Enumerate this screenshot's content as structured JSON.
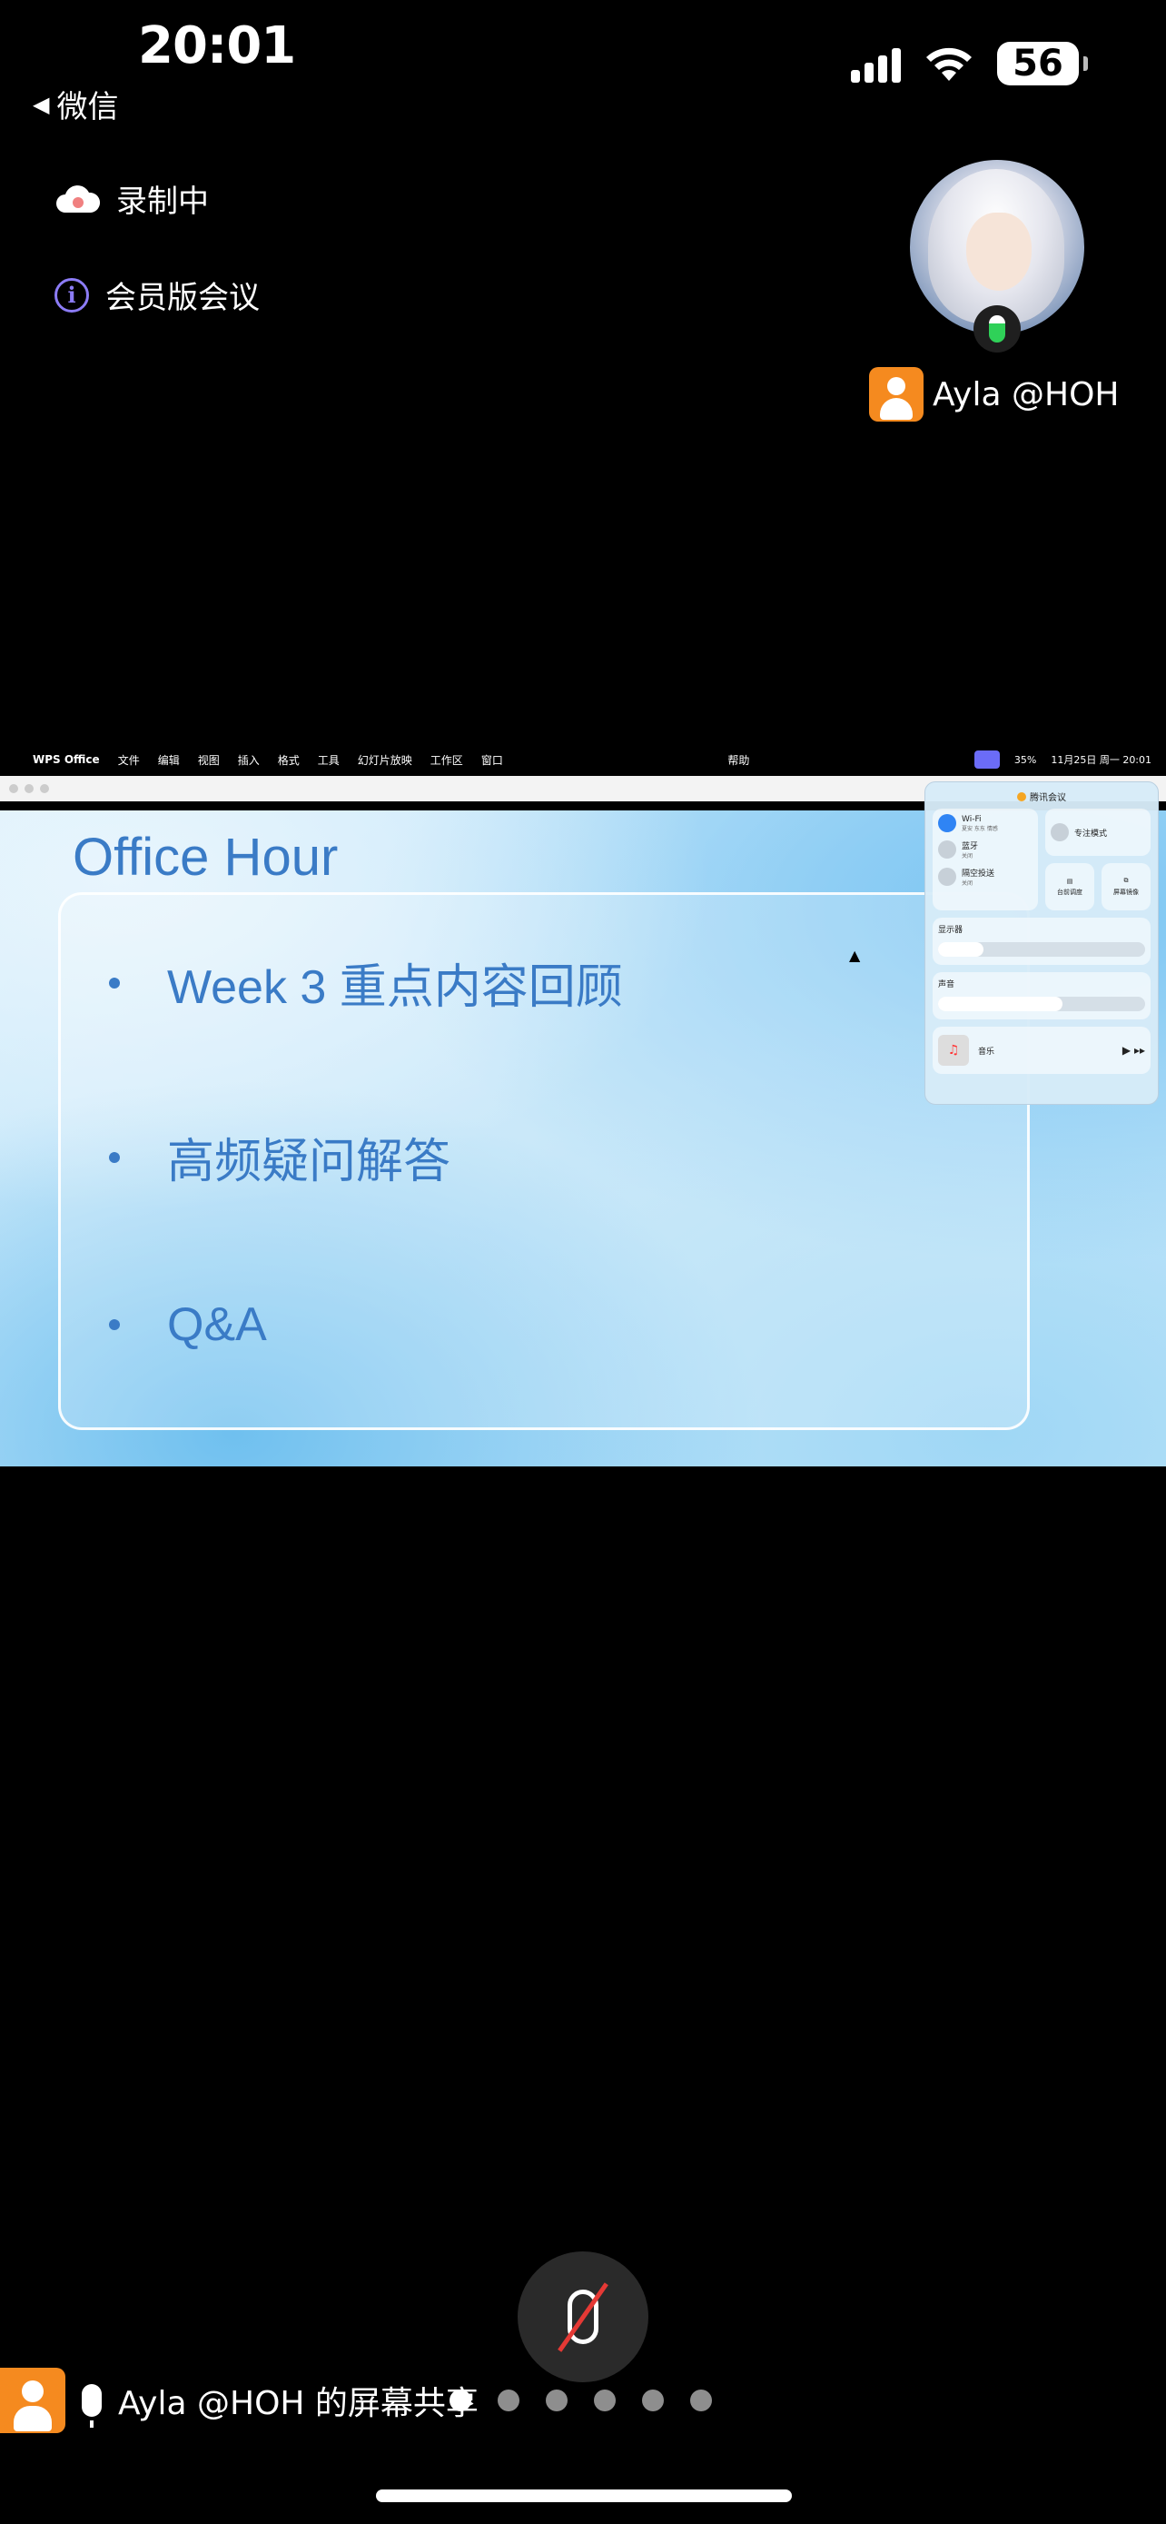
{
  "status_bar": {
    "time": "20:01",
    "back_app": "微信",
    "battery": "56"
  },
  "meeting": {
    "recording_label": "录制中",
    "member_meeting_label": "会员版会议",
    "participant_name": "Ayla @HOH"
  },
  "shared_screen": {
    "menubar": {
      "app_name": "WPS Office",
      "menus": [
        "文件",
        "编辑",
        "视图",
        "插入",
        "格式",
        "工具",
        "幻灯片放映",
        "工作区",
        "窗口"
      ],
      "help": "帮助",
      "battery_percent": "35%",
      "datetime": "11月25日 周一  20:01"
    },
    "slide": {
      "title": "Office Hour",
      "bullets": [
        "Week 3 重点内容回顾",
        "高频疑问解答",
        "Q&A"
      ]
    },
    "control_center": {
      "header": "腾讯会议",
      "wifi_label": "Wi-Fi",
      "wifi_sub": "夏安 东东 情感",
      "bluetooth_label": "蓝牙",
      "bluetooth_sub": "关闭",
      "airdrop_label": "隔空投送",
      "airdrop_sub": "关闭",
      "focus_label": "专注模式",
      "stage_label": "台前调度",
      "mirror_label": "屏幕镜像",
      "display_label": "显示器",
      "display_level": 0.22,
      "sound_label": "声音",
      "sound_level": 0.6,
      "music_label": "音乐"
    }
  },
  "bottom": {
    "share_label": "Ayla @HOH 的屏幕共享",
    "page_count": 6,
    "active_page": 0
  }
}
